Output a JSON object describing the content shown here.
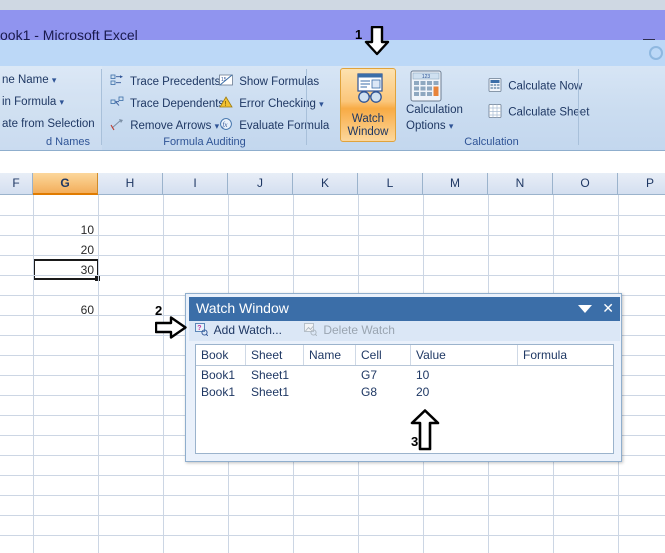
{
  "window": {
    "title": "ook1 - Microsoft Excel",
    "minimize_label": "minimize"
  },
  "ribbon": {
    "groups": [
      {
        "name": "defined-names",
        "label": "d Names",
        "items": [
          {
            "label": "ne Name",
            "caret": "▾"
          },
          {
            "label": "in Formula",
            "caret": "▾"
          },
          {
            "label": "ate from Selection",
            "caret": ""
          }
        ]
      },
      {
        "name": "formula-auditing",
        "label": "Formula Auditing",
        "items": [
          {
            "label": "Trace Precedents",
            "caret": "",
            "icon": "trace-precedents-icon"
          },
          {
            "label": "Trace Dependents",
            "caret": "",
            "icon": "trace-dependents-icon"
          },
          {
            "label": "Remove Arrows",
            "caret": "▾",
            "icon": "remove-arrows-icon"
          },
          {
            "label": "Show Formulas",
            "caret": "",
            "icon": "show-formulas-icon"
          },
          {
            "label": "Error Checking",
            "caret": "▾",
            "icon": "error-checking-icon"
          },
          {
            "label": "Evaluate Formula",
            "caret": "",
            "icon": "evaluate-formula-icon"
          }
        ]
      },
      {
        "name": "calculation",
        "label": "Calculation",
        "items": [
          {
            "label": "Calculation",
            "caret": "",
            "icon": "calculation-options-icon"
          },
          {
            "label": "Options",
            "caret": "▾",
            "icon": ""
          },
          {
            "label": "Calculate Now",
            "caret": "",
            "icon": "calculate-now-icon"
          },
          {
            "label": "Calculate Sheet",
            "caret": "",
            "icon": "calculate-sheet-icon"
          }
        ]
      }
    ],
    "watch_window_button": {
      "line1": "Watch",
      "line2": "Window",
      "selected": true,
      "accent_color": "#f8ab45"
    }
  },
  "sheet": {
    "columns": [
      "F",
      "G",
      "H",
      "I",
      "J",
      "K",
      "L",
      "M",
      "N",
      "O",
      "P"
    ],
    "selected_column": "G",
    "selected_cell": "G9",
    "cells": [
      {
        "col": "G",
        "row": 7,
        "value": "10"
      },
      {
        "col": "G",
        "row": 8,
        "value": "20"
      },
      {
        "col": "G",
        "row": 9,
        "value": "30"
      },
      {
        "col": "G",
        "row": 11,
        "value": "60"
      }
    ]
  },
  "watch_window": {
    "title": "Watch Window",
    "dropdown_icon": "chevron-down-icon",
    "close_icon": "close-icon",
    "toolbar": {
      "add_watch": "Add Watch...",
      "delete_watch": "Delete Watch",
      "delete_watch_disabled": true
    },
    "table": {
      "headers": [
        "Book",
        "Sheet",
        "Name",
        "Cell",
        "Value",
        "Formula"
      ],
      "rows": [
        {
          "book": "Book1",
          "sheet": "Sheet1",
          "name": "",
          "cell": "G7",
          "value": "10",
          "formula": ""
        },
        {
          "book": "Book1",
          "sheet": "Sheet1",
          "name": "",
          "cell": "G8",
          "value": "20",
          "formula": ""
        }
      ]
    }
  },
  "annotations": [
    {
      "id": "1",
      "label": "1",
      "direction": "down"
    },
    {
      "id": "2",
      "label": "2",
      "direction": "right"
    },
    {
      "id": "3",
      "label": "3",
      "direction": "up"
    }
  ]
}
